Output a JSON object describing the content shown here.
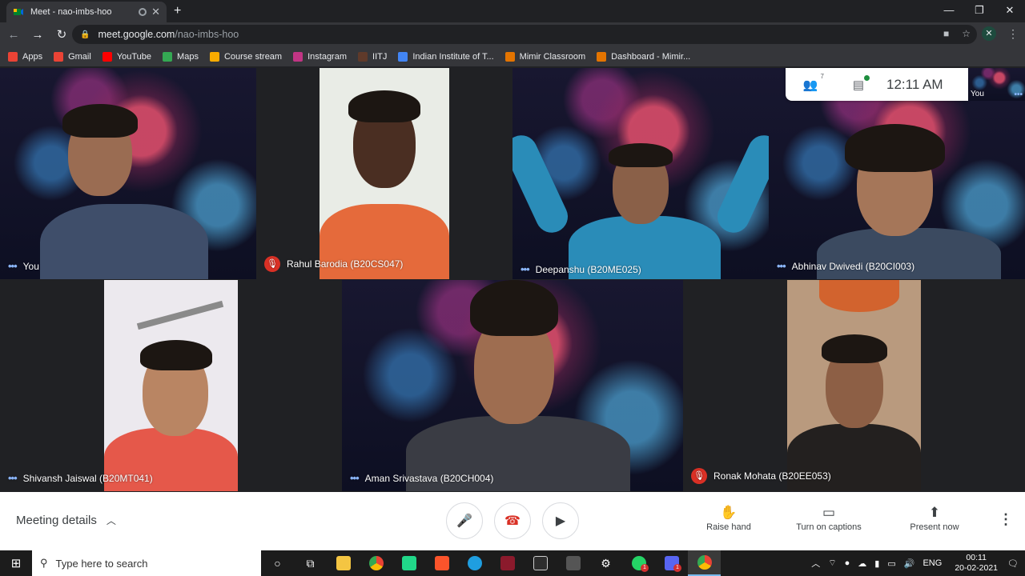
{
  "browser": {
    "tab_title": "Meet - nao-imbs-hoo",
    "new_tab_icon": "+",
    "url_host": "meet.google.com",
    "url_path": "/nao-imbs-hoo",
    "window_controls": [
      "—",
      "❐",
      "✕"
    ]
  },
  "bookmarks": [
    {
      "label": "Apps",
      "color": "#ea4335"
    },
    {
      "label": "Gmail",
      "color": "#ea4335"
    },
    {
      "label": "YouTube",
      "color": "#ff0000"
    },
    {
      "label": "Maps",
      "color": "#34a853"
    },
    {
      "label": "Course stream",
      "color": "#f9ab00"
    },
    {
      "label": "Instagram",
      "color": "#c13584"
    },
    {
      "label": "IITJ",
      "color": "#5f3a2a"
    },
    {
      "label": "Indian Institute of T...",
      "color": "#4285f4"
    },
    {
      "label": "Mimir Classroom",
      "color": "#e37400"
    },
    {
      "label": "Dashboard - Mimir...",
      "color": "#e37400"
    }
  ],
  "participants": [
    {
      "name": "You",
      "muted": false
    },
    {
      "name": "Rahul Barodia (B20CS047)",
      "muted": true
    },
    {
      "name": "Deepanshu (B20ME025)",
      "muted": false
    },
    {
      "name": "Abhinav Dwivedi (B20CI003)",
      "muted": false
    },
    {
      "name": "Shivansh Jaiswal (B20MT041)",
      "muted": false
    },
    {
      "name": "Aman Srivastava (B20CH004)",
      "muted": false
    },
    {
      "name": "Ronak Mohata (B20EE053)",
      "muted": true
    }
  ],
  "info_card": {
    "people_count": "7",
    "time": "12:11 AM"
  },
  "self_view": {
    "label": "You"
  },
  "controls": {
    "meeting_details": "Meeting details",
    "raise_hand": "Raise hand",
    "captions": "Turn on captions",
    "present": "Present now"
  },
  "taskbar": {
    "search_placeholder": "Type here to search",
    "lang": "ENG",
    "time": "00:11",
    "date": "20-02-2021",
    "badge_whatsapp": "1",
    "badge_discord": "1"
  }
}
